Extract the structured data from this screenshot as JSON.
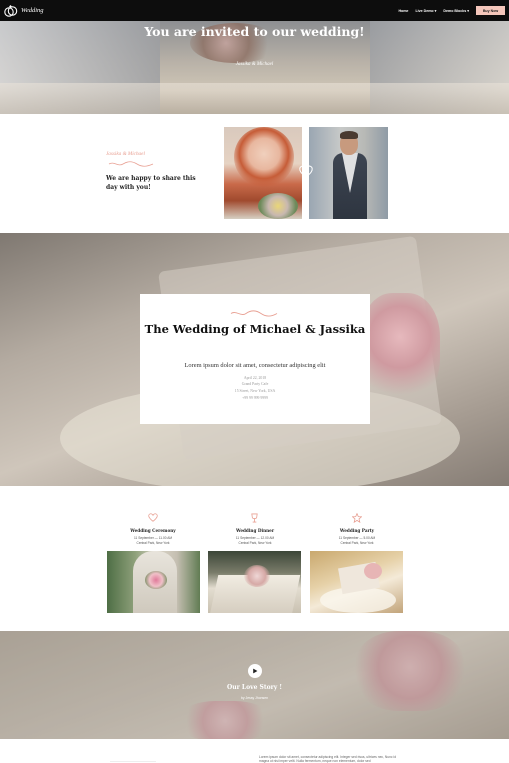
{
  "nav": {
    "brand": "Wedding",
    "links": [
      "Home",
      "Live Demo ▾",
      "Demo Blocks ▾"
    ],
    "buy_label": "Buy Now"
  },
  "hero": {
    "title": "You are invited to our wedding!",
    "subtitle": "Jassika & Michael"
  },
  "couple": {
    "names": "Jassika & Michael",
    "text": "We are happy to share this day with you!"
  },
  "banner": {
    "title": "The Wedding of Michael & Jassika",
    "lead": "Lorem ipsum dolor sit amet, consectetur adipiscing elit",
    "date": "April 22, 2018",
    "venue": "Grand Party Cafe",
    "address": "15 Street, New York, USA",
    "phone": "+99 99 999 9999"
  },
  "events": [
    {
      "title": "Wedding Ceremony",
      "time": "11 September — 11.00 AM",
      "place": "Central Park, New York",
      "icon": "heart-icon"
    },
    {
      "title": "Wedding Dinner",
      "time": "11 September — 12.00 AM",
      "place": "Central Park, New York",
      "icon": "glass-icon"
    },
    {
      "title": "Wedding Party",
      "time": "11 September — 5.00 AM",
      "place": "Central Park, New York",
      "icon": "star-icon"
    }
  ],
  "story": {
    "title": "Our Love Story !",
    "subtitle": "by Jessy Jhonsen"
  },
  "bottom": {
    "text": "Lorem ipsum dolor sit amet, consectetur adipiscing elit. Integer sed risus, ultrices nec, Nunc id magna ut nisi imper velit. Nulla fermentum, neque non elementum, dolor sed"
  },
  "colors": {
    "accent": "#f4c6bb",
    "script_pink": "#e8a093",
    "nav_bg": "#0d0d0d"
  }
}
